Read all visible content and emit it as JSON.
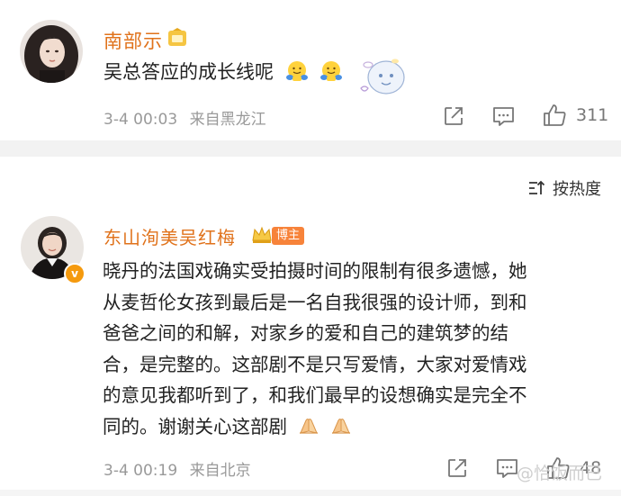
{
  "comment_top": {
    "username": "南部示",
    "text": "吴总答应的成长线呢",
    "time": "3-4 00:03",
    "location": "来自黑龙江",
    "likes": "311"
  },
  "sort": {
    "label": "按热度"
  },
  "comment_main": {
    "username": "东山洵美吴红梅",
    "role_badge": "博主",
    "verified_mark": "v",
    "lines": [
      "晓丹的法国戏确实受拍摄时间的限制有很多遗憾，她",
      "从麦哲伦女孩到最后是一名自我很强的设计师，到和",
      "爸爸之间的和解，对家乡的爱和自己的建筑梦的结",
      "合，是完整的。这部剧不是只写爱情，大家对爱情戏",
      "的意见我都听到了，和我们最早的设想确实是完全不",
      "同的。谢谢关心这部剧"
    ],
    "time": "3-4 00:19",
    "location": "来自北京",
    "likes": "48"
  },
  "watermark": "@恰饭而已",
  "icons": {
    "share": "share-icon",
    "comment": "comment-icon",
    "like": "thumbs-up-icon",
    "sort": "sort-icon",
    "crown": "crown-icon"
  },
  "colors": {
    "username": "#e0721b",
    "badge": "#f7833a",
    "meta": "#999999",
    "separator": "#f2f2f2"
  }
}
